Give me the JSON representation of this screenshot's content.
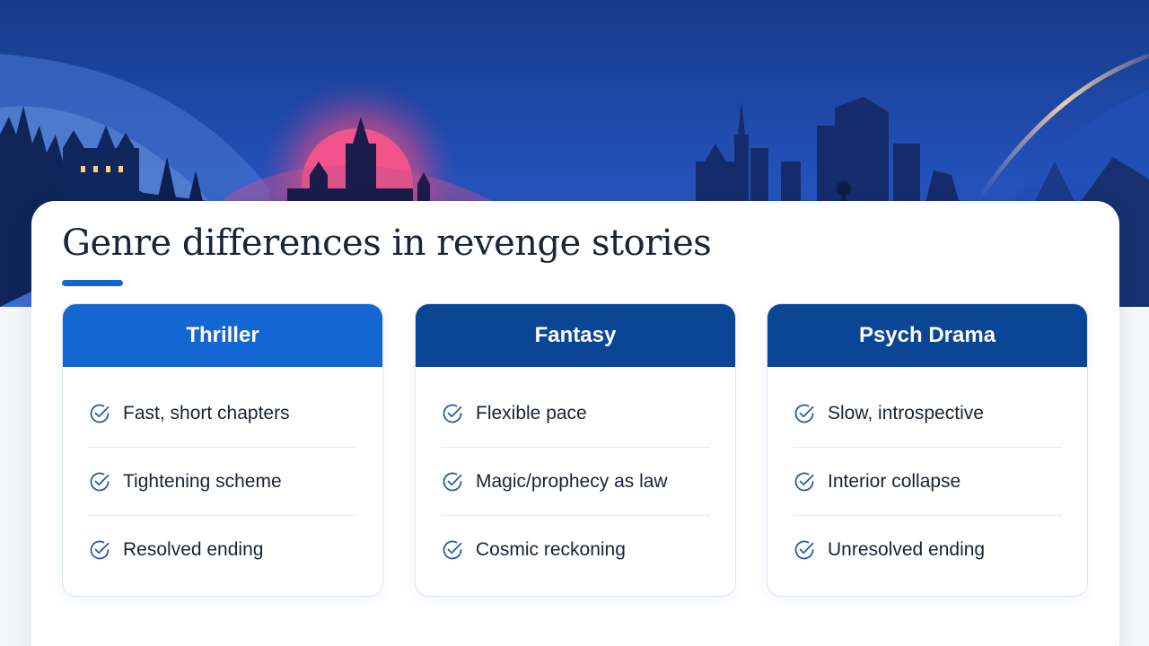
{
  "slide": {
    "title": "Genre differences in revenge stories"
  },
  "colors": {
    "accent": "#1863d0",
    "header_primary": "#1466d2",
    "header_dark": "#0b4595",
    "text": "#1a2233"
  },
  "genres": [
    {
      "name": "Thriller",
      "header_color": "#1466d2",
      "items": [
        "Fast, short chapters",
        "Tightening scheme",
        "Resolved ending"
      ]
    },
    {
      "name": "Fantasy",
      "header_color": "#0b4595",
      "items": [
        "Flexible pace",
        "Magic/prophecy as law",
        "Cosmic reckoning"
      ]
    },
    {
      "name": "Psych Drama",
      "header_color": "#0b4595",
      "items": [
        "Slow, introspective",
        "Interior collapse",
        "Unresolved ending"
      ]
    }
  ],
  "icons": {
    "item_icon": "check-circle-icon"
  }
}
